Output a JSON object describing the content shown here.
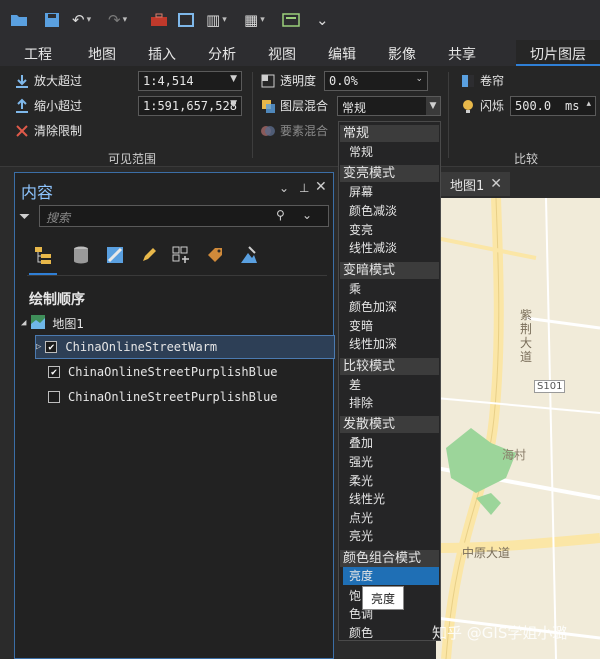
{
  "ribbon_tabs": [
    "工程",
    "地图",
    "插入",
    "分析",
    "视图",
    "编辑",
    "影像",
    "共享",
    "切片图层"
  ],
  "visible_range": {
    "zoom_in_label": "放大超过",
    "zoom_in_value": "1:4,514",
    "zoom_out_label": "缩小超过",
    "zoom_out_value": "1:591,657,528",
    "clear_label": "清除限制",
    "caption": "可见范围"
  },
  "effects": {
    "transparency_label": "透明度",
    "transparency_value": "0.0%",
    "blend_label": "图层混合",
    "blend_value": "常规",
    "feature_blend_label": "要素混合"
  },
  "compare": {
    "swipe_label": "卷帘",
    "flicker_label": "闪烁",
    "flicker_value": "500.0",
    "flicker_unit": "ms",
    "caption": "比较"
  },
  "contents": {
    "title": "内容",
    "search_placeholder": "搜索",
    "draw_order_title": "绘制顺序",
    "map_name": "地图1",
    "layers": [
      {
        "name": "ChinaOnlineStreetWarm",
        "checked": true
      },
      {
        "name": "ChinaOnlineStreetPurplishBlue",
        "checked": true
      },
      {
        "name": "ChinaOnlineStreetPurplishBlue",
        "checked": false
      }
    ]
  },
  "map_view": {
    "tab_label": "地图1",
    "labels": [
      "紫荆大道",
      "S101",
      "海村",
      "中原大道"
    ]
  },
  "blend_dropdown": {
    "groups": [
      {
        "header": "常规",
        "items": [
          "常规"
        ]
      },
      {
        "header": "变亮模式",
        "items": [
          "屏幕",
          "颜色减淡",
          "变亮",
          "线性减淡"
        ]
      },
      {
        "header": "变暗模式",
        "items": [
          "乘",
          "颜色加深",
          "变暗",
          "线性加深"
        ]
      },
      {
        "header": "比较模式",
        "items": [
          "差",
          "排除"
        ]
      },
      {
        "header": "发散模式",
        "items": [
          "叠加",
          "强光",
          "柔光",
          "线性光",
          "点光",
          "亮光"
        ]
      },
      {
        "header": "颜色组合模式",
        "items": [
          "亮度",
          "饱",
          "色调",
          "颜色"
        ]
      }
    ],
    "highlighted": "亮度"
  },
  "tooltip": "亮度",
  "watermark": "知乎 @GIS学姐小璐",
  "colors": {
    "accent": "#2f7fd6",
    "pane_title": "#8ec5ff",
    "highlight": "#1f6fb5"
  }
}
